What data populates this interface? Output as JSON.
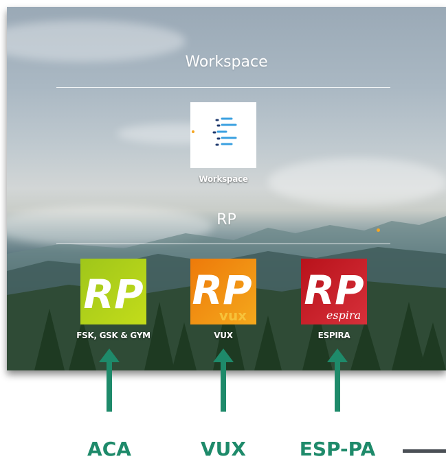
{
  "workspace_section": {
    "title": "Workspace"
  },
  "workspace_app": {
    "label": "Workspace"
  },
  "rp_section": {
    "title": "RP"
  },
  "rp_apps": [
    {
      "label": "FSK, GSK & GYM",
      "logo_text": "RP",
      "sub_text": "",
      "colors": [
        "#a8cc1c",
        "#c3dc1a"
      ]
    },
    {
      "label": "VUX",
      "logo_text": "RP",
      "sub_text": "vux",
      "colors": [
        "#f07d0a",
        "#f3a51a"
      ]
    },
    {
      "label": "ESPIRA",
      "logo_text": "RP",
      "sub_text": "espira",
      "colors": [
        "#c0151f",
        "#d7303a"
      ]
    }
  ],
  "annotations": [
    {
      "label": "ACA",
      "icon": "arrow-up-icon"
    },
    {
      "label": "VUX",
      "icon": "arrow-up-icon"
    },
    {
      "label": "ESP-PA",
      "icon": "arrow-up-icon"
    }
  ],
  "colors": {
    "annotation": "#1e8a6a",
    "accent_dot": "#f5a623"
  }
}
